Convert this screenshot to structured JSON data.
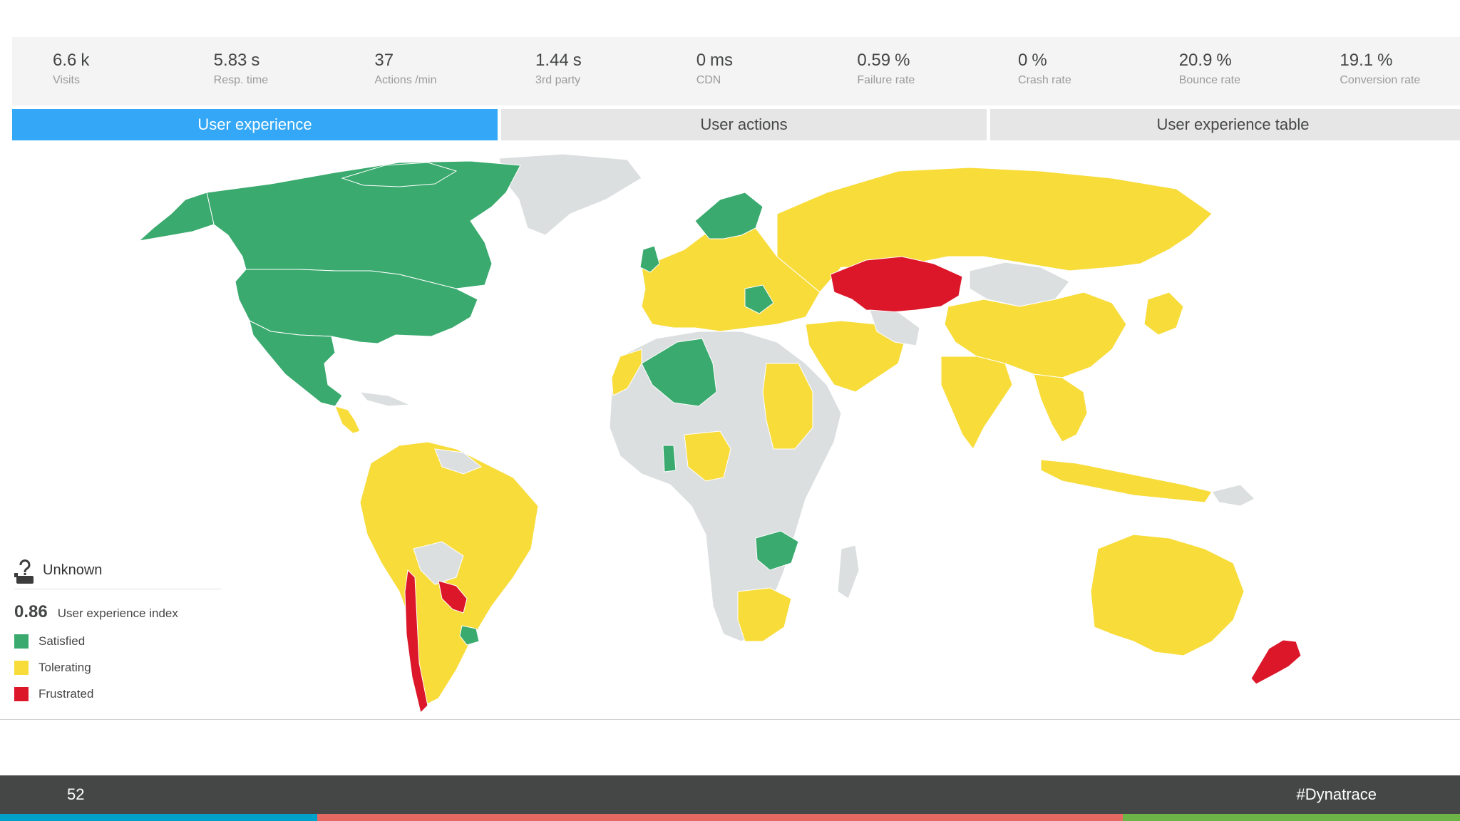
{
  "kpis": [
    {
      "value": "6.6",
      "unit": "k",
      "label": "Visits"
    },
    {
      "value": "5.83",
      "unit": "s",
      "label": "Resp. time"
    },
    {
      "value": "37",
      "unit": "",
      "label": "Actions /min"
    },
    {
      "value": "1.44",
      "unit": "s",
      "label": "3rd party"
    },
    {
      "value": "0",
      "unit": "ms",
      "label": "CDN"
    },
    {
      "value": "0.59",
      "unit": "%",
      "label": "Failure rate"
    },
    {
      "value": "0",
      "unit": "%",
      "label": "Crash rate"
    },
    {
      "value": "20.9",
      "unit": "%",
      "label": "Bounce rate"
    },
    {
      "value": "19.1",
      "unit": "%",
      "label": "Conversion rate"
    }
  ],
  "tabs": [
    {
      "label": "User experience",
      "active": true
    },
    {
      "label": "User actions",
      "active": false
    },
    {
      "label": "User experience table",
      "active": false
    }
  ],
  "legend": {
    "unknown_label": "Unknown",
    "index_value": "0.86",
    "index_label": "User experience index",
    "items": [
      {
        "label": "Satisfied",
        "color": "#3aaa6e"
      },
      {
        "label": "Tolerating",
        "color": "#f8dc3a"
      },
      {
        "label": "Frustrated",
        "color": "#dc172a"
      }
    ]
  },
  "map_colors": {
    "satisfied": "#3aaa6e",
    "tolerating": "#f8dc3a",
    "frustrated": "#dc172a",
    "unknown": "#dcdfe0"
  },
  "footer": {
    "page_number": "52",
    "hashtag": "#Dynatrace"
  },
  "stripe_colors": [
    "#00a1c9",
    "#e56863",
    "#6bb445"
  ]
}
